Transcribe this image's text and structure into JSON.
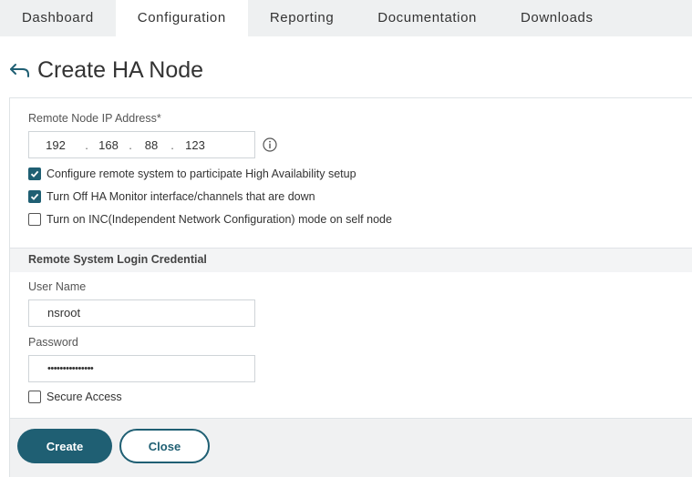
{
  "nav": {
    "tabs": [
      {
        "label": "Dashboard"
      },
      {
        "label": "Configuration",
        "active": true
      },
      {
        "label": "Reporting"
      },
      {
        "label": "Documentation"
      },
      {
        "label": "Downloads"
      }
    ]
  },
  "header": {
    "title": "Create HA Node",
    "back_icon": "back-arrow-icon"
  },
  "form": {
    "remote_ip_label": "Remote Node IP Address*",
    "ip": [
      "192",
      "168",
      "88",
      "123"
    ],
    "ip_dot": ".",
    "info_icon": "info-icon",
    "checks": [
      {
        "label": "Configure remote system to participate High Availability setup",
        "checked": true
      },
      {
        "label": "Turn Off HA Monitor interface/channels that are down",
        "checked": true
      },
      {
        "label": "Turn on INC(Independent Network Configuration) mode on self node",
        "checked": false
      }
    ],
    "credential_section": "Remote System Login Credential",
    "username_label": "User Name",
    "username_value": "nsroot",
    "password_label": "Password",
    "password_value": "•••••••••••••••",
    "secure_access_label": "Secure Access",
    "secure_access_checked": false
  },
  "actions": {
    "create_label": "Create",
    "close_label": "Close"
  },
  "colors": {
    "accent": "#1f5f73",
    "nav_bg": "#eef0f1"
  }
}
